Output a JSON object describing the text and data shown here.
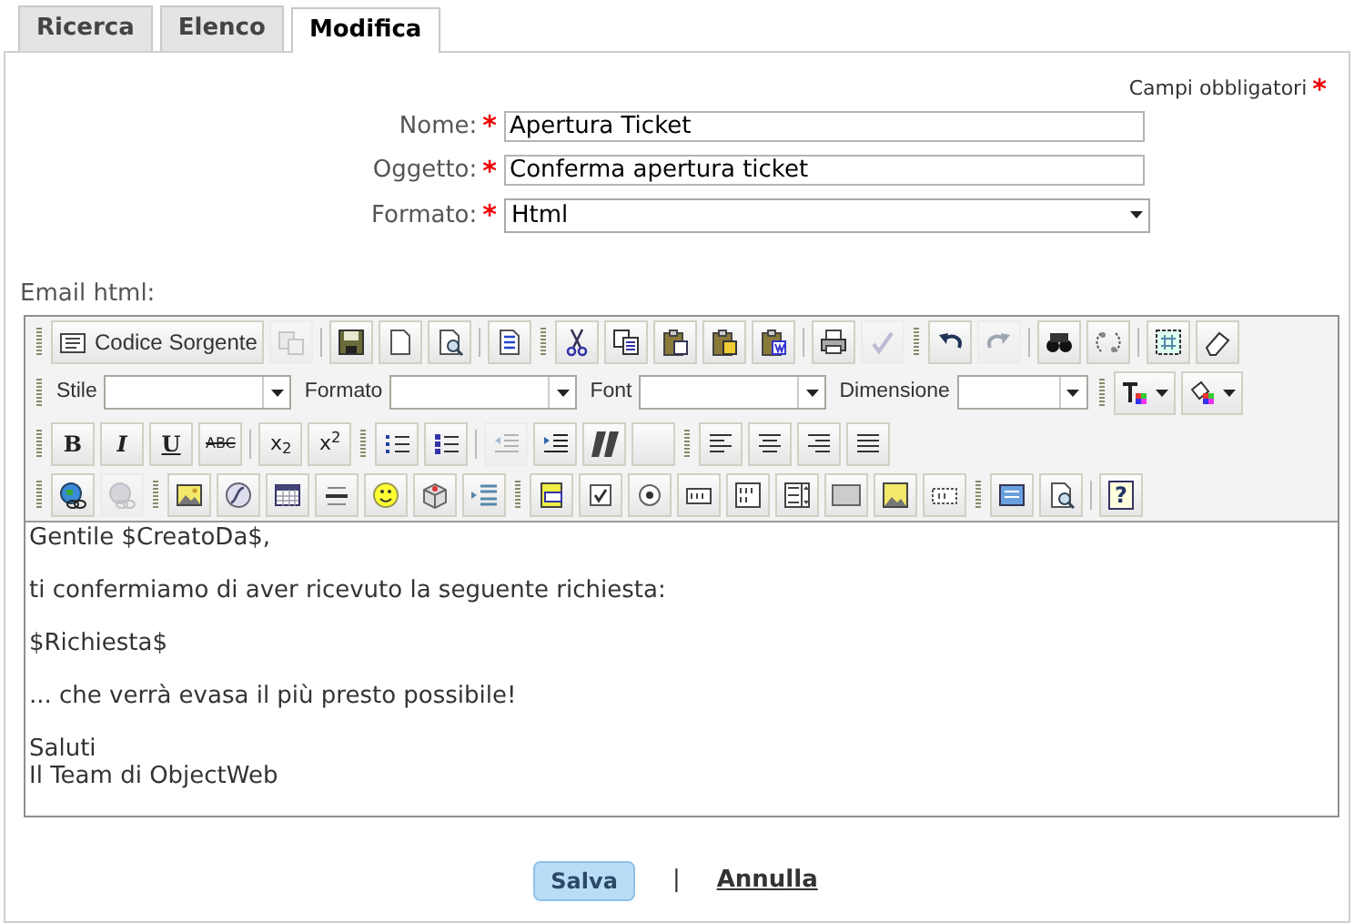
{
  "tabs": [
    {
      "label": "Ricerca",
      "selected": false
    },
    {
      "label": "Elenco",
      "selected": false
    },
    {
      "label": "Modifica",
      "selected": true
    }
  ],
  "required_note": {
    "text": "Campi obbligatori",
    "marker": "*"
  },
  "fields": [
    {
      "label": "Nome:",
      "marker": "*",
      "kind": "text",
      "value": "Apertura Ticket"
    },
    {
      "label": "Oggetto:",
      "marker": "*",
      "kind": "text",
      "value": "Conferma apertura ticket"
    },
    {
      "label": "Formato:",
      "marker": "*",
      "kind": "select",
      "value": "Html"
    }
  ],
  "editor": {
    "label": "Email html:",
    "toolbar": [
      [
        {
          "kind": "grip"
        },
        {
          "kind": "source",
          "label": "Codice Sorgente",
          "disabled": false
        },
        {
          "kind": "button",
          "disabled": true
        },
        {
          "kind": "sep"
        },
        {
          "kind": "button",
          "disabled": false
        },
        {
          "kind": "button",
          "disabled": false
        },
        {
          "kind": "button",
          "disabled": false
        },
        {
          "kind": "sep"
        },
        {
          "kind": "button",
          "disabled": false
        },
        {
          "kind": "grip"
        },
        {
          "kind": "button",
          "disabled": false
        },
        {
          "kind": "button",
          "disabled": false
        },
        {
          "kind": "button",
          "disabled": false
        },
        {
          "kind": "button",
          "disabled": false
        },
        {
          "kind": "button",
          "disabled": false
        },
        {
          "kind": "sep"
        },
        {
          "kind": "button",
          "disabled": false
        },
        {
          "kind": "button",
          "disabled": true
        },
        {
          "kind": "grip"
        },
        {
          "kind": "button",
          "disabled": false
        },
        {
          "kind": "button",
          "disabled": true
        },
        {
          "kind": "sep"
        },
        {
          "kind": "button",
          "disabled": false
        },
        {
          "kind": "button",
          "disabled": false
        },
        {
          "kind": "sep"
        },
        {
          "kind": "button",
          "disabled": false
        },
        {
          "kind": "button",
          "disabled": false
        }
      ],
      [
        {
          "kind": "grip"
        },
        {
          "kind": "combo",
          "label": "Stile"
        },
        {
          "kind": "combo",
          "label": "Formato"
        },
        {
          "kind": "combo",
          "label": "Font"
        },
        {
          "kind": "combo",
          "label": "Dimensione"
        },
        {
          "kind": "grip"
        },
        {
          "kind": "color",
          "disabled": false
        },
        {
          "kind": "color",
          "disabled": false
        }
      ],
      [
        {
          "kind": "grip"
        },
        {
          "kind": "glyph",
          "glyph": "B",
          "disabled": false
        },
        {
          "kind": "glyph",
          "glyph": "I",
          "disabled": false
        },
        {
          "kind": "glyph",
          "glyph": "U",
          "disabled": false
        },
        {
          "kind": "glyph",
          "glyph": "ABC",
          "disabled": false
        },
        {
          "kind": "sep"
        },
        {
          "kind": "glyph",
          "glyph": "x$_{2}$",
          "disabled": false
        },
        {
          "kind": "glyph",
          "glyph": "x$^{2}$",
          "disabled": false
        },
        {
          "kind": "grip"
        },
        {
          "kind": "button",
          "disabled": false
        },
        {
          "kind": "button",
          "disabled": false
        },
        {
          "kind": "sep"
        },
        {
          "kind": "button",
          "disabled": true
        },
        {
          "kind": "button",
          "disabled": false
        },
        {
          "kind": "button",
          "disabled": false
        },
        {
          "kind": "button",
          "disabled": false
        },
        {
          "kind": "grip"
        },
        {
          "kind": "button",
          "disabled": false
        },
        {
          "kind": "button",
          "disabled": false
        },
        {
          "kind": "button",
          "disabled": false
        },
        {
          "kind": "button",
          "disabled": false
        }
      ],
      [
        {
          "kind": "grip"
        },
        {
          "kind": "button",
          "disabled": false
        },
        {
          "kind": "button",
          "disabled": true
        },
        {
          "kind": "grip"
        },
        {
          "kind": "button",
          "disabled": false
        },
        {
          "kind": "button",
          "disabled": false
        },
        {
          "kind": "button",
          "disabled": false
        },
        {
          "kind": "button",
          "disabled": false
        },
        {
          "kind": "button",
          "disabled": false
        },
        {
          "kind": "button",
          "disabled": false
        },
        {
          "kind": "button",
          "disabled": false
        },
        {
          "kind": "grip"
        },
        {
          "kind": "button",
          "disabled": false
        },
        {
          "kind": "button",
          "disabled": false
        },
        {
          "kind": "button",
          "disabled": false
        },
        {
          "kind": "button",
          "disabled": false
        },
        {
          "kind": "button",
          "disabled": false
        },
        {
          "kind": "button",
          "disabled": false
        },
        {
          "kind": "button",
          "disabled": false
        },
        {
          "kind": "button",
          "disabled": false
        },
        {
          "kind": "button",
          "disabled": false
        },
        {
          "kind": "grip"
        },
        {
          "kind": "button",
          "disabled": false
        },
        {
          "kind": "button",
          "disabled": false
        },
        {
          "kind": "sep"
        },
        {
          "kind": "glyph",
          "glyph": "?",
          "disabled": false
        }
      ]
    ],
    "content": [
      {
        "lines": [
          "Gentile $CreatoDa$,"
        ]
      },
      {
        "lines": [
          "ti confermiamo di aver ricevuto la seguente richiesta:"
        ]
      },
      {
        "lines": [
          "$Richiesta$"
        ]
      },
      {
        "lines": [
          "... che verrà evasa il più presto possibile!"
        ]
      },
      {
        "lines": [
          "Saluti",
          "Il Team di ObjectWeb"
        ]
      }
    ]
  },
  "actions": {
    "save": "Salva",
    "separator": "|",
    "cancel": "Annulla"
  }
}
